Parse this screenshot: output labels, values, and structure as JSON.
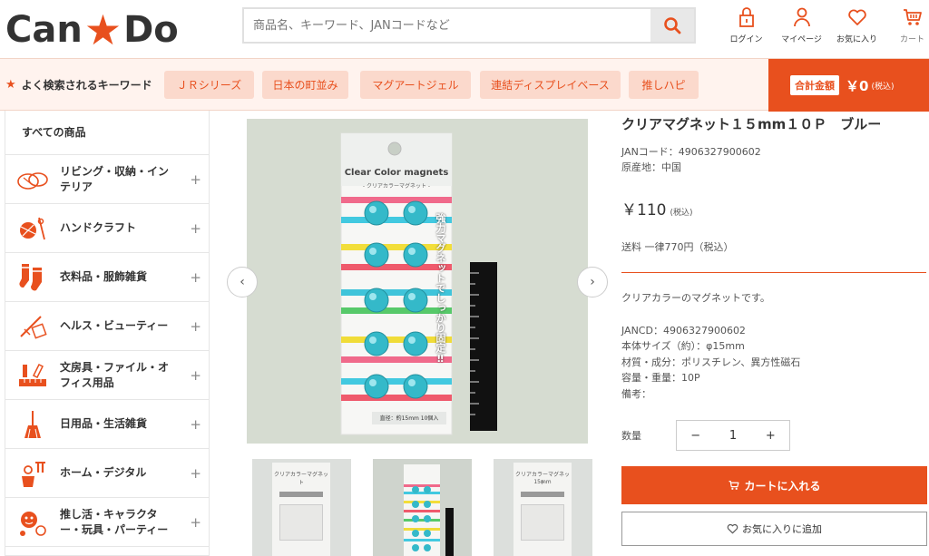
{
  "header": {
    "logo_left": "Can",
    "logo_right": "Do",
    "search_placeholder": "商品名、キーワード、JANコードなど",
    "icons": [
      {
        "name": "login-icon",
        "label": "ログイン"
      },
      {
        "name": "user-icon",
        "label": "マイページ"
      },
      {
        "name": "heart-icon",
        "label": "お気に入り"
      },
      {
        "name": "cart-icon",
        "label": "カート"
      }
    ]
  },
  "keywords": {
    "title": "よく検索されるキーワード",
    "items": [
      "ＪＲシリーズ",
      "日本の町並み",
      "マグアートジェル",
      "連結ディスプレイベース",
      "推しハピ"
    ],
    "total_label": "合計金額",
    "total_value": "￥0",
    "total_tax": "(税込)"
  },
  "sidebar": {
    "all_label": "すべての商品",
    "items": [
      {
        "icon": "basket-icon",
        "label": "リビング・収納・インテリア"
      },
      {
        "icon": "craft-icon",
        "label": "ハンドクラフト"
      },
      {
        "icon": "socks-icon",
        "label": "衣料品・服飾雑貨"
      },
      {
        "icon": "beauty-icon",
        "label": "ヘルス・ビューティー"
      },
      {
        "icon": "stationery-icon",
        "label": "文房具・ファイル・オフィス用品"
      },
      {
        "icon": "broom-icon",
        "label": "日用品・生活雑貨"
      },
      {
        "icon": "tools-icon",
        "label": "ホーム・デジタル"
      },
      {
        "icon": "party-icon",
        "label": "推し活・キャラクター・玩具・パーティー"
      }
    ]
  },
  "gallery": {
    "package_title": "Clear Color magnets",
    "package_subtitle": "- クリアカラーマグネット -",
    "package_vertical": "強力マグネットでしっかり固定‼",
    "package_bottom": "直径：約15mm 10個入",
    "thumb_title": "クリアカラーマグネット",
    "thumb_sub": "15mm"
  },
  "product": {
    "title": "クリアマグネット１５mm１０Ｐ　ブルー",
    "jan": "JANコード：4906327900602",
    "origin": "原産地：中国",
    "price": "￥110",
    "price_tax": "(税込)",
    "shipping": "送料 一律770円（税込）",
    "description": "クリアカラーのマグネットです。",
    "specs": [
      "JANCD：4906327900602",
      "本体サイズ（約）：φ15mm",
      "材質・成分：ポリスチレン、異方性磁石",
      "容量・重量：10P",
      "備考："
    ],
    "qty_label": "数量",
    "qty_value": "1",
    "minus": "−",
    "plus": "+",
    "cart_button": "カートに入れる",
    "fav_button": "お気に入りに追加"
  },
  "colors": {
    "accent": "#e8501e",
    "keyword_bg": "#fbd9cc"
  }
}
